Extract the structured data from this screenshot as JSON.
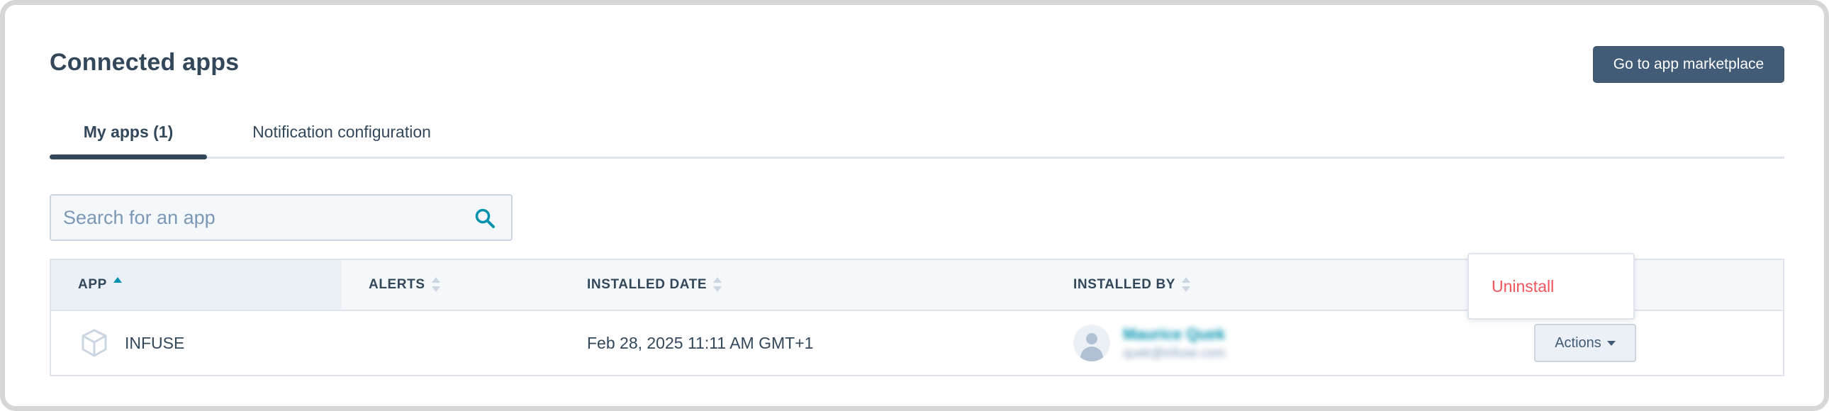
{
  "page": {
    "title": "Connected apps",
    "marketplace_button": "Go to app marketplace"
  },
  "tabs": [
    {
      "label": "My apps (1)",
      "active": true
    },
    {
      "label": "Notification configuration",
      "active": false
    }
  ],
  "search": {
    "placeholder": "Search for an app",
    "value": "",
    "icon": "search-icon"
  },
  "table": {
    "columns": [
      {
        "label": "APP",
        "sort": "ascending"
      },
      {
        "label": "ALERTS",
        "sort": "none"
      },
      {
        "label": "INSTALLED DATE",
        "sort": "none"
      },
      {
        "label": "INSTALLED BY",
        "sort": "none"
      }
    ],
    "rows": [
      {
        "app": "INFUSE",
        "app_icon": "cube-icon",
        "alerts": "",
        "installed_date": "Feb 28, 2025 11:11 AM GMT+1",
        "installed_by_name": "Maurice Quek",
        "installed_by_email": "quek@infuse.com",
        "actions_label": "Actions"
      }
    ]
  },
  "dropdown_menu": {
    "items": [
      {
        "label": "Uninstall"
      }
    ]
  },
  "colors": {
    "primary_button": "#425b76",
    "text": "#33475b",
    "link": "#0091ae",
    "danger": "#f2545b",
    "header_bg": "#f5f8fa",
    "border": "#dfe3eb"
  }
}
